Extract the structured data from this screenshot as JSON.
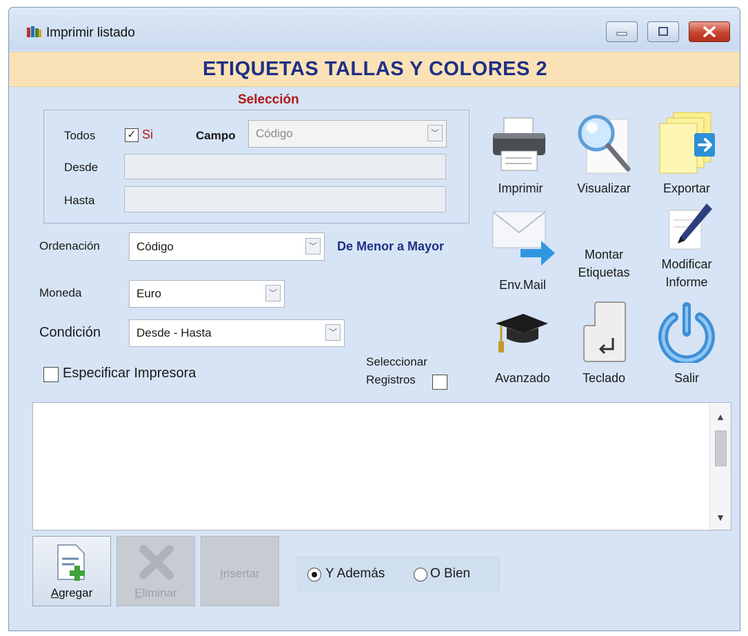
{
  "window": {
    "title": "Imprimir listado",
    "heading": "ETIQUETAS TALLAS Y COLORES 2"
  },
  "selection": {
    "title": "Selección",
    "todos_label": "Todos",
    "si_label": "Si",
    "si_checked": true,
    "campo_label": "Campo",
    "campo_value": "Código",
    "desde_label": "Desde",
    "desde_value": "",
    "hasta_label": "Hasta",
    "hasta_value": ""
  },
  "options": {
    "ordenacion_label": "Ordenación",
    "ordenacion_value": "Código",
    "order_direction": "De Menor a Mayor",
    "moneda_label": "Moneda",
    "moneda_value": "Euro",
    "condicion_label": "Condición",
    "condicion_value": "Desde - Hasta",
    "especificar_impresora_label": "Especificar Impresora",
    "seleccionar_registros_line1": "Seleccionar",
    "seleccionar_registros_line2": "Registros"
  },
  "toolbar": {
    "imprimir": "Imprimir",
    "visualizar": "Visualizar",
    "exportar": "Exportar",
    "envmail": "Env.Mail",
    "montar_line1": "Montar",
    "montar_line2": "Etiquetas",
    "modificar_line1": "Modificar",
    "modificar_line2": "Informe",
    "avanzado": "Avanzado",
    "teclado": "Teclado",
    "salir": "Salir"
  },
  "bottom": {
    "agregar_first": "A",
    "agregar_rest": "gregar",
    "eliminar_first": "E",
    "eliminar_rest": "liminar",
    "insertar_first": "I",
    "insertar_rest": "nsertar",
    "y_ademas": "Y Además",
    "o_bien": "O Bien",
    "selected_radio": "Y Además"
  },
  "colors": {
    "window_bg": "#d6e4f5",
    "banner_bg": "#fbe2b6",
    "banner_text": "#1f2f86",
    "selection_title": "#b01818",
    "order_direction": "#1f2f86"
  },
  "icons": [
    "app-icon",
    "printer-icon",
    "magnifier-icon",
    "export-icon",
    "mail-icon",
    "pencil-icon",
    "graduation-cap-icon",
    "enter-key-icon",
    "power-icon",
    "add-document-icon",
    "delete-x-icon"
  ]
}
